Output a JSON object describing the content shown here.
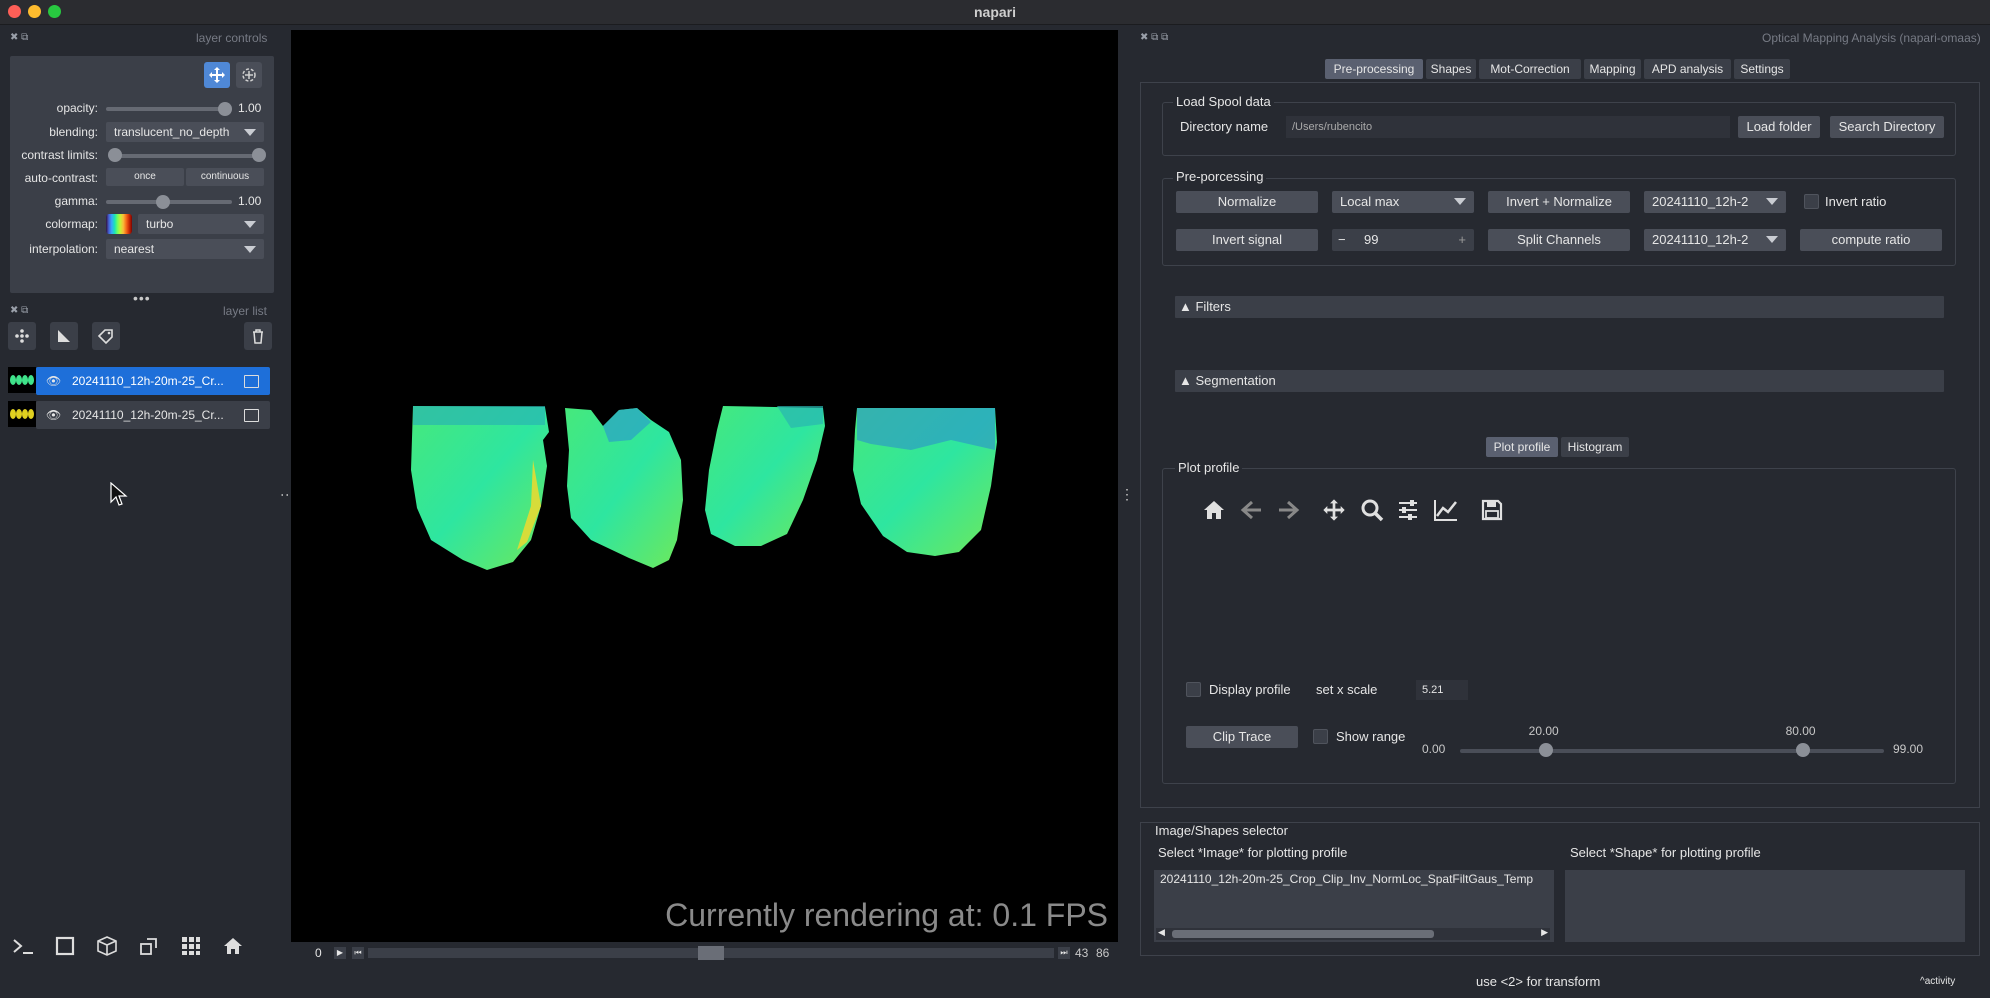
{
  "window": {
    "title": "napari"
  },
  "left": {
    "layer_controls_title": "layer controls",
    "layer_list_title": "layer list",
    "controls": {
      "opacity_label": "opacity:",
      "opacity_value": "1.00",
      "opacity": 1.0,
      "blending_label": "blending:",
      "blending_value": "translucent_no_depth",
      "contrast_label": "contrast limits:",
      "contrast_range": [
        0.0,
        1.0
      ],
      "autocontrast_label": "auto-contrast:",
      "once_label": "once",
      "continuous_label": "continuous",
      "gamma_label": "gamma:",
      "gamma_value": "1.00",
      "gamma": 0.45,
      "colormap_label": "colormap:",
      "colormap_value": "turbo",
      "interpolation_label": "interpolation:",
      "interpolation_value": "nearest"
    },
    "layers": [
      {
        "name": "20241110_12h-20m-25_Cr...",
        "selected": true
      },
      {
        "name": "20241110_12h-20m-25_Cr...",
        "selected": false
      }
    ]
  },
  "viewer": {
    "fps_text": "Currently rendering at: 0.1 FPS",
    "slider_start": "0",
    "slider_current": "43",
    "slider_max": "86",
    "slider_fraction": 0.5
  },
  "right": {
    "dock_title": "Optical Mapping Analysis (napari-omaas)",
    "tabs": [
      "Pre-processing",
      "Shapes",
      "Mot-Correction",
      "Mapping",
      "APD analysis",
      "Settings"
    ],
    "active_tab": 0,
    "load_spool": {
      "title": "Load Spool data",
      "dir_label": "Directory name",
      "dir_value": "/Users/rubencito",
      "load_btn": "Load folder",
      "search_btn": "Search Directory"
    },
    "preprocessing": {
      "title": "Pre-porcessing",
      "normalize": "Normalize",
      "local_max": "Local max",
      "invert_normalize": "Invert + Normalize",
      "combo1": "20241110_12h-2",
      "invert_ratio": "Invert ratio",
      "invert_signal": "Invert signal",
      "spin_minus": "−",
      "spin_value": "99",
      "spin_plus": "+",
      "split_channels": "Split Channels",
      "combo2": "20241110_12h-2",
      "compute_ratio": "compute ratio"
    },
    "filters": "▲ Filters",
    "segmentation": "▲ Segmentation",
    "plot_tabs": [
      "Plot profile",
      "Histogram"
    ],
    "plot_profile": {
      "title": "Plot profile",
      "display_profile": "Display profile",
      "set_x_scale": "set x scale",
      "x_scale": "5.21",
      "clip_trace": "Clip Trace",
      "show_range": "Show range",
      "range_min": "0.00",
      "range_max": "99.00",
      "low_val": "20.00",
      "high_val": "80.00",
      "low_fraction": 0.202,
      "high_fraction": 0.808
    },
    "selector": {
      "title": "Image/Shapes selector",
      "image_label": "Select *Image* for plotting profile",
      "shape_label": "Select *Shape* for plotting profile",
      "image_item": "20241110_12h-20m-25_Crop_Clip_Inv_NormLoc_SpatFiltGaus_Temp"
    }
  },
  "status": {
    "hint": "use <2> for transform",
    "activity": "activity"
  }
}
